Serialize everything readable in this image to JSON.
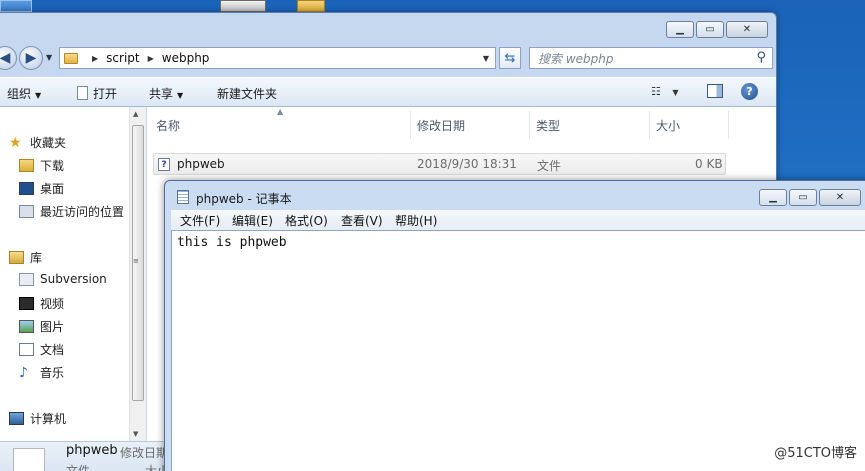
{
  "colors": {
    "desktop": "#1f6fc4",
    "window_frame": "#c5d8ef",
    "selected_row": "#ececec"
  },
  "explorer": {
    "breadcrumb": [
      "script",
      "webphp"
    ],
    "search_placeholder": "搜索 webphp",
    "toolbar": {
      "organize": "组织",
      "open": "打开",
      "share": "共享",
      "new_folder": "新建文件夹"
    },
    "sidebar": {
      "favorites": "收藏夹",
      "downloads": "下载",
      "desktop": "桌面",
      "recent": "最近访问的位置",
      "libraries": "库",
      "subversion": "Subversion",
      "videos": "视频",
      "pictures": "图片",
      "documents": "文档",
      "music": "音乐",
      "computer": "计算机"
    },
    "columns": {
      "name": "名称",
      "modified": "修改日期",
      "type": "类型",
      "size": "大小"
    },
    "files": [
      {
        "name": "phpweb",
        "modified": "2018/9/30 18:31",
        "type": "文件",
        "size": "0 KB"
      }
    ],
    "details": {
      "name": "phpweb",
      "modified_label": "修改日期",
      "type_label": "文件",
      "size_label": "大小"
    }
  },
  "notepad": {
    "title": "phpweb - 记事本",
    "menu": [
      "文件(F)",
      "编辑(E)",
      "格式(O)",
      "查看(V)",
      "帮助(H)"
    ],
    "content": "this is phpweb"
  },
  "watermark": "@51CTO博客"
}
